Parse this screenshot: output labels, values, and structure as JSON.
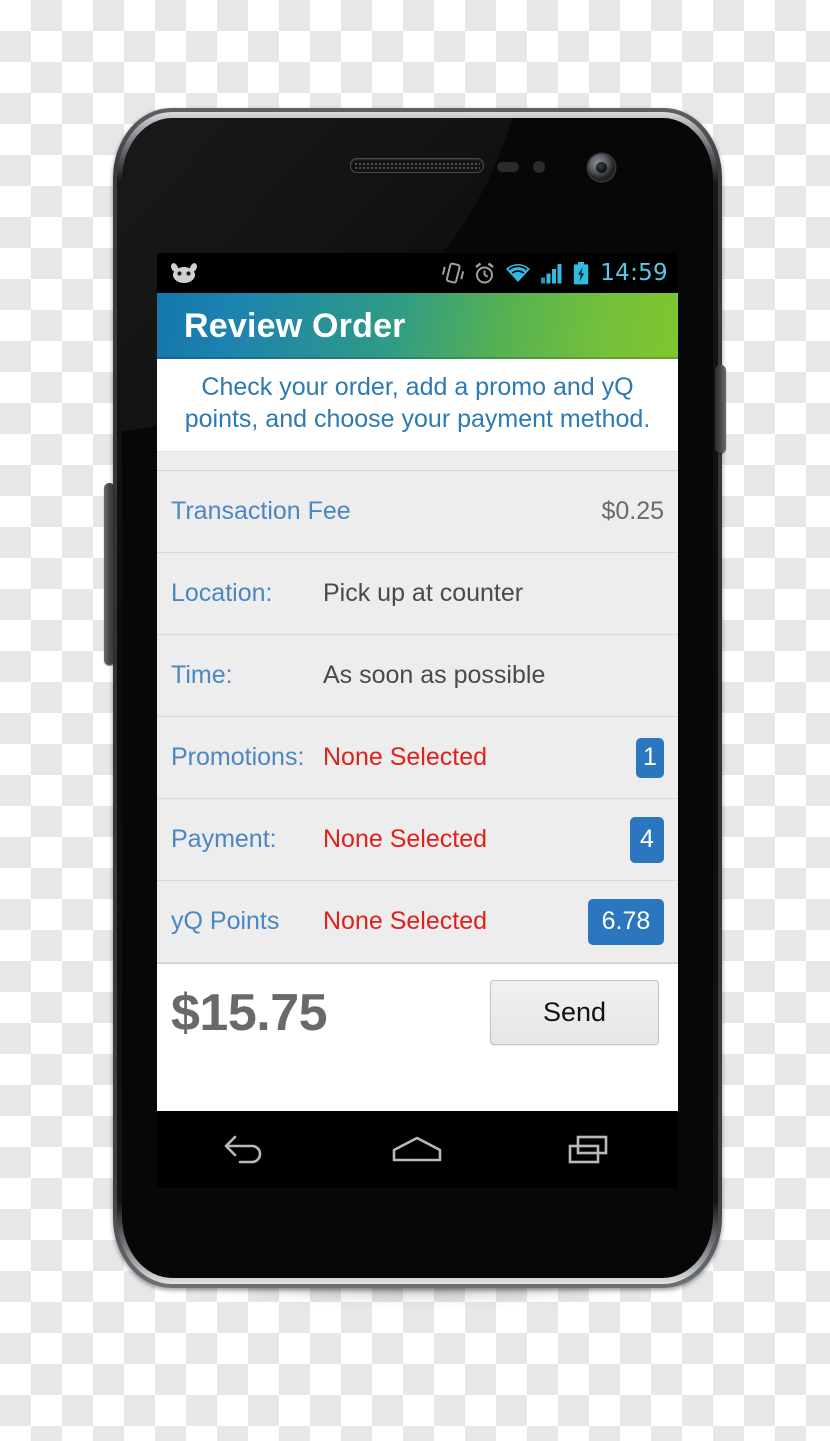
{
  "device": {
    "name": "android-smartphone",
    "hardware": {
      "earpiece": "earpiece-speaker",
      "front_camera": "front-camera",
      "volume_button": "volume-rocker",
      "power_button": "power-button"
    }
  },
  "status_bar": {
    "os_icon": "android-head-icon",
    "icons": [
      "vibrate-icon",
      "alarm-icon",
      "wifi-icon",
      "signal-icon",
      "battery-charging-icon"
    ],
    "time": "14:59",
    "time_color": "#56c8e8"
  },
  "app": {
    "title": "Review Order",
    "title_gradient_start": "#1476ad",
    "title_gradient_end": "#81c62e",
    "instructions": "Check your order, add a promo and yQ points, and choose your payment method."
  },
  "order": {
    "fee_row": {
      "label": "Transaction Fee",
      "value": "$0.25"
    },
    "rows": [
      {
        "label": "Location:",
        "value": "Pick up at counter",
        "value_style": "normal",
        "badge": null
      },
      {
        "label": "Time:",
        "value": "As soon as possible",
        "value_style": "normal",
        "badge": null
      },
      {
        "label": "Promotions:",
        "value": "None Selected",
        "value_style": "red",
        "badge": "1",
        "badge_size": "small"
      },
      {
        "label": "Payment:",
        "value": "None Selected",
        "value_style": "red",
        "badge": "4",
        "badge_size": "medium"
      },
      {
        "label": "yQ Points",
        "value": "None Selected",
        "value_style": "red",
        "badge": "6.78",
        "badge_size": "large"
      }
    ],
    "badge_color": "#2a77c0",
    "unselected_color": "#e0201b",
    "label_color": "#4b87c2"
  },
  "footer": {
    "total": "$15.75",
    "send_label": "Send"
  },
  "nav_bar": {
    "buttons": [
      "back-icon",
      "home-icon",
      "recent-apps-icon"
    ]
  }
}
